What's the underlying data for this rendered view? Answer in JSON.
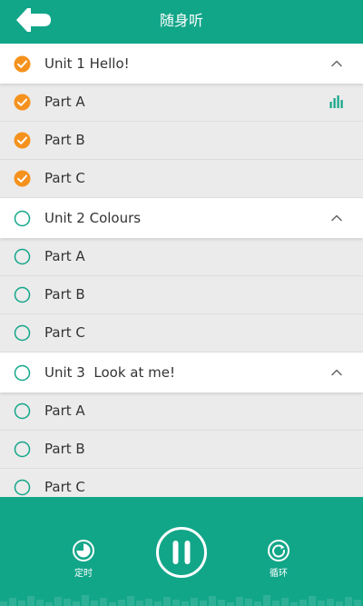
{
  "header": {
    "title": "随身听"
  },
  "units": [
    {
      "title": "Unit 1 Hello!",
      "state": "checked",
      "expanded": true,
      "parts": [
        {
          "label": "Part A",
          "state": "checked",
          "playing": true
        },
        {
          "label": "Part B",
          "state": "checked",
          "playing": false
        },
        {
          "label": "Part C",
          "state": "checked",
          "playing": false
        }
      ]
    },
    {
      "title": "Unit 2 Colours",
      "state": "unchecked",
      "expanded": true,
      "parts": [
        {
          "label": "Part A",
          "state": "unchecked",
          "playing": false
        },
        {
          "label": "Part B",
          "state": "unchecked",
          "playing": false
        },
        {
          "label": "Part C",
          "state": "unchecked",
          "playing": false
        }
      ]
    },
    {
      "title": "Unit 3  Look at me!",
      "state": "unchecked",
      "expanded": true,
      "parts": [
        {
          "label": "Part A",
          "state": "unchecked",
          "playing": false
        },
        {
          "label": "Part B",
          "state": "unchecked",
          "playing": false
        },
        {
          "label": "Part C",
          "state": "unchecked",
          "playing": false
        }
      ]
    }
  ],
  "player": {
    "timer_label": "定时",
    "loop_label": "循环",
    "play_state": "playing"
  },
  "colors": {
    "primary": "#12a689",
    "checked": "#f5921e",
    "unchecked_outline": "#12a689"
  },
  "icons": {
    "back": "back-arrow-icon",
    "checked": "check-circle-icon",
    "unchecked": "empty-circle-icon",
    "chevron": "chevron-up-icon",
    "playing": "equalizer-icon",
    "timer": "timer-icon",
    "pause": "pause-icon",
    "loop": "loop-icon"
  }
}
